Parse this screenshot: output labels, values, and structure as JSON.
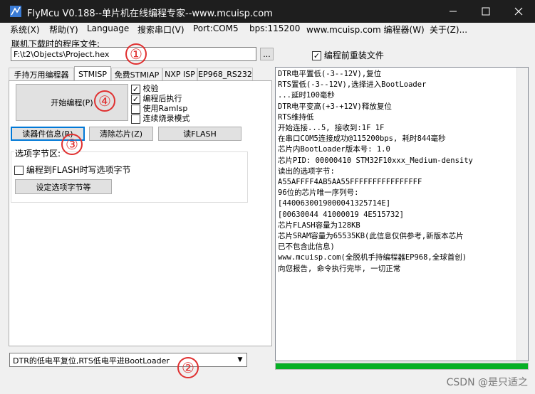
{
  "window": {
    "title": "FlyMcu V0.188--单片机在线编程专家--www.mcuisp.com",
    "minimize_icon": "minimize-icon",
    "maximize_icon": "maximize-icon",
    "close_icon": "close-icon"
  },
  "menu": [
    {
      "label": "系统(X)"
    },
    {
      "label": "帮助(Y)"
    },
    {
      "label": "Language"
    },
    {
      "label": "搜索串口(V)"
    },
    {
      "label": "Port:COM5"
    },
    {
      "label": "bps:115200"
    },
    {
      "label": "www.mcuisp.com 编程器(W)"
    },
    {
      "label": "关于(Z)..."
    }
  ],
  "file": {
    "label": "联机下载时的程序文件:",
    "path": "F:\\t2\\Objects\\Project.hex",
    "browse_label": "...",
    "reload_checked": true,
    "reload_label": "编程前重装文件"
  },
  "tabs": [
    {
      "label": "手持万用编程器"
    },
    {
      "label": "STMISP"
    },
    {
      "label": "免费STMIAP"
    },
    {
      "label": "NXP ISP"
    },
    {
      "label": "EP968_RS232"
    }
  ],
  "stmisp": {
    "start_button": "开始编程(P)",
    "options": [
      {
        "label": "校验",
        "checked": true
      },
      {
        "label": "编程后执行",
        "checked": true
      },
      {
        "label": "使用RamIsp",
        "checked": false
      },
      {
        "label": "连续烧录模式",
        "checked": false
      }
    ],
    "read_info_button": "读器件信息(R)",
    "erase_button": "清除芯片(Z)",
    "read_flash_button": "读FLASH",
    "option_bytes_group": "选项字节区:",
    "write_option_label": "编程到FLASH时写选项字节",
    "write_option_checked": false,
    "set_option_button": "设定选项字节等"
  },
  "reset_mode": {
    "selected": "DTR的低电平复位,RTS低电平进BootLoader"
  },
  "log_lines": [
    "DTR电平置低(-3--12V),复位",
    "RTS置低(-3--12V),选择进入BootLoader",
    "...延时100毫秒",
    "DTR电平变高(+3-+12V)释放复位",
    "RTS维持低",
    "开始连接...5, 接收到:1F 1F",
    "在串口COM5连接成功@115200bps, 耗时844毫秒",
    "芯片内BootLoader版本号: 1.0",
    "芯片PID: 00000410  STM32F10xxx_Medium-density",
    "读出的选项字节:",
    "A55AFFFF4AB5AA55FFFFFFFFFFFFFFFF",
    "96位的芯片唯一序列号:",
    "[4400630019000041325714E]",
    "[00630044 41000019 4E515732]",
    "芯片FLASH容量为128KB",
    "芯片SRAM容量为65535KB(此信息仅供参考,新版本芯片",
    "已不包含此信息)",
    "www.mcuisp.com(全脱机手持编程器EP968,全球首创)",
    "向您报告, 命令执行完毕, 一切正常"
  ],
  "progress": {
    "value": 1.0,
    "color": "#06b025"
  },
  "annotations": [
    "①",
    "②",
    "③",
    "④"
  ],
  "watermark": "CSDN @是只适之"
}
